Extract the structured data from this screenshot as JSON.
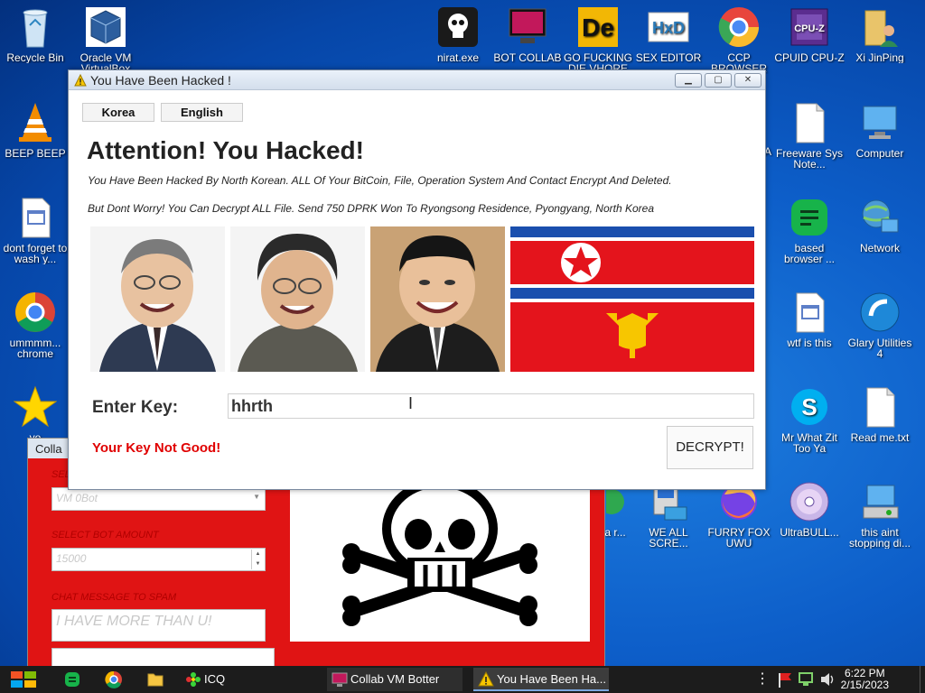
{
  "desktop": {
    "icons": [
      {
        "label": "Recycle Bin",
        "icon": "recycle-bin-icon"
      },
      {
        "label": "Oracle VM VirtualBox",
        "icon": "virtualbox-icon"
      },
      {
        "label": "nirat.exe",
        "icon": "skull-icon"
      },
      {
        "label": "BOT COLLAB",
        "icon": "monitor-icon"
      },
      {
        "label": "GO FUCKING DIE VHORE",
        "icon": "de-icon"
      },
      {
        "label": "SEX EDITOR",
        "icon": "hxd-icon"
      },
      {
        "label": "CCP BROWSER",
        "icon": "chromium-icon"
      },
      {
        "label": "CPUID CPU-Z",
        "icon": "cpuz-icon"
      },
      {
        "label": "Xi JinPing",
        "icon": "user-folder-icon"
      },
      {
        "label": "BEEP BEEP",
        "icon": "vlc-icon"
      },
      {
        "label": "A",
        "icon": "partial-icon"
      },
      {
        "label": "Freeware Sys Note...",
        "icon": "document-icon"
      },
      {
        "label": "Computer",
        "icon": "computer-icon"
      },
      {
        "label": "dont forget to wash y...",
        "icon": "calendar-file-icon"
      },
      {
        "label": "based browser ...",
        "icon": "docs-icon"
      },
      {
        "label": "Network",
        "icon": "network-icon"
      },
      {
        "label": "ummmm... chrome",
        "icon": "chrome-icon"
      },
      {
        "label": "wtf is this",
        "icon": "calendar-file-icon"
      },
      {
        "label": "Glary Utilities 4",
        "icon": "glary-icon"
      },
      {
        "label": "yo",
        "icon": "star-icon"
      },
      {
        "label": "Mr What Zit Too Ya",
        "icon": "skype-icon"
      },
      {
        "label": "Read me.txt",
        "icon": "text-file-icon"
      },
      {
        "label": "a r...",
        "icon": "partial-icon"
      },
      {
        "label": "WE ALL SCRE...",
        "icon": "setup-icon"
      },
      {
        "label": "FURRY FOX UWU",
        "icon": "firefox-icon"
      },
      {
        "label": "UltraBULL...",
        "icon": "disc-icon"
      },
      {
        "label": "this aint stopping di...",
        "icon": "installer-icon"
      }
    ]
  },
  "botter": {
    "title": "Collab VM Botter",
    "title_visible": "Colla",
    "select_label_partial": "SEL",
    "vm_value": "VM 0Bot",
    "amount_label": "SELECT BOT AMOUNT",
    "amount_value": "15000",
    "chat_label": "CHAT MESSAGE TO SPAM",
    "chat_value": "I HAVE MORE THAN U!"
  },
  "ransom": {
    "title": "You Have Been Hacked !",
    "lang_korea": "Korea",
    "lang_english": "English",
    "heading": "Attention! You Hacked!",
    "line1": "You Have Been Hacked By North Korean. ALL Of Your BitCoin, File,  Operation System And Contact Encrypt And Deleted.",
    "line2": "But Dont Worry! You Can Decrypt ALL File. Send 750 DPRK Won To Ryongsong Residence, Pyongyang, North Korea",
    "key_label": "Enter Key:",
    "key_value": "hhrth",
    "error": "Your Key Not Good!",
    "decrypt": "DECRYPT!"
  },
  "taskbar": {
    "tasks": [
      {
        "label": "ICQ"
      },
      {
        "label": "Collab VM Botter"
      },
      {
        "label": "You Have Been Ha..."
      }
    ],
    "time": "6:22 PM",
    "date": "2/15/2023"
  },
  "colors": {
    "desktop": "#0d5ec9",
    "error": "#e00000",
    "flag_red": "#e4141c",
    "flag_blue": "#1a4fae"
  }
}
